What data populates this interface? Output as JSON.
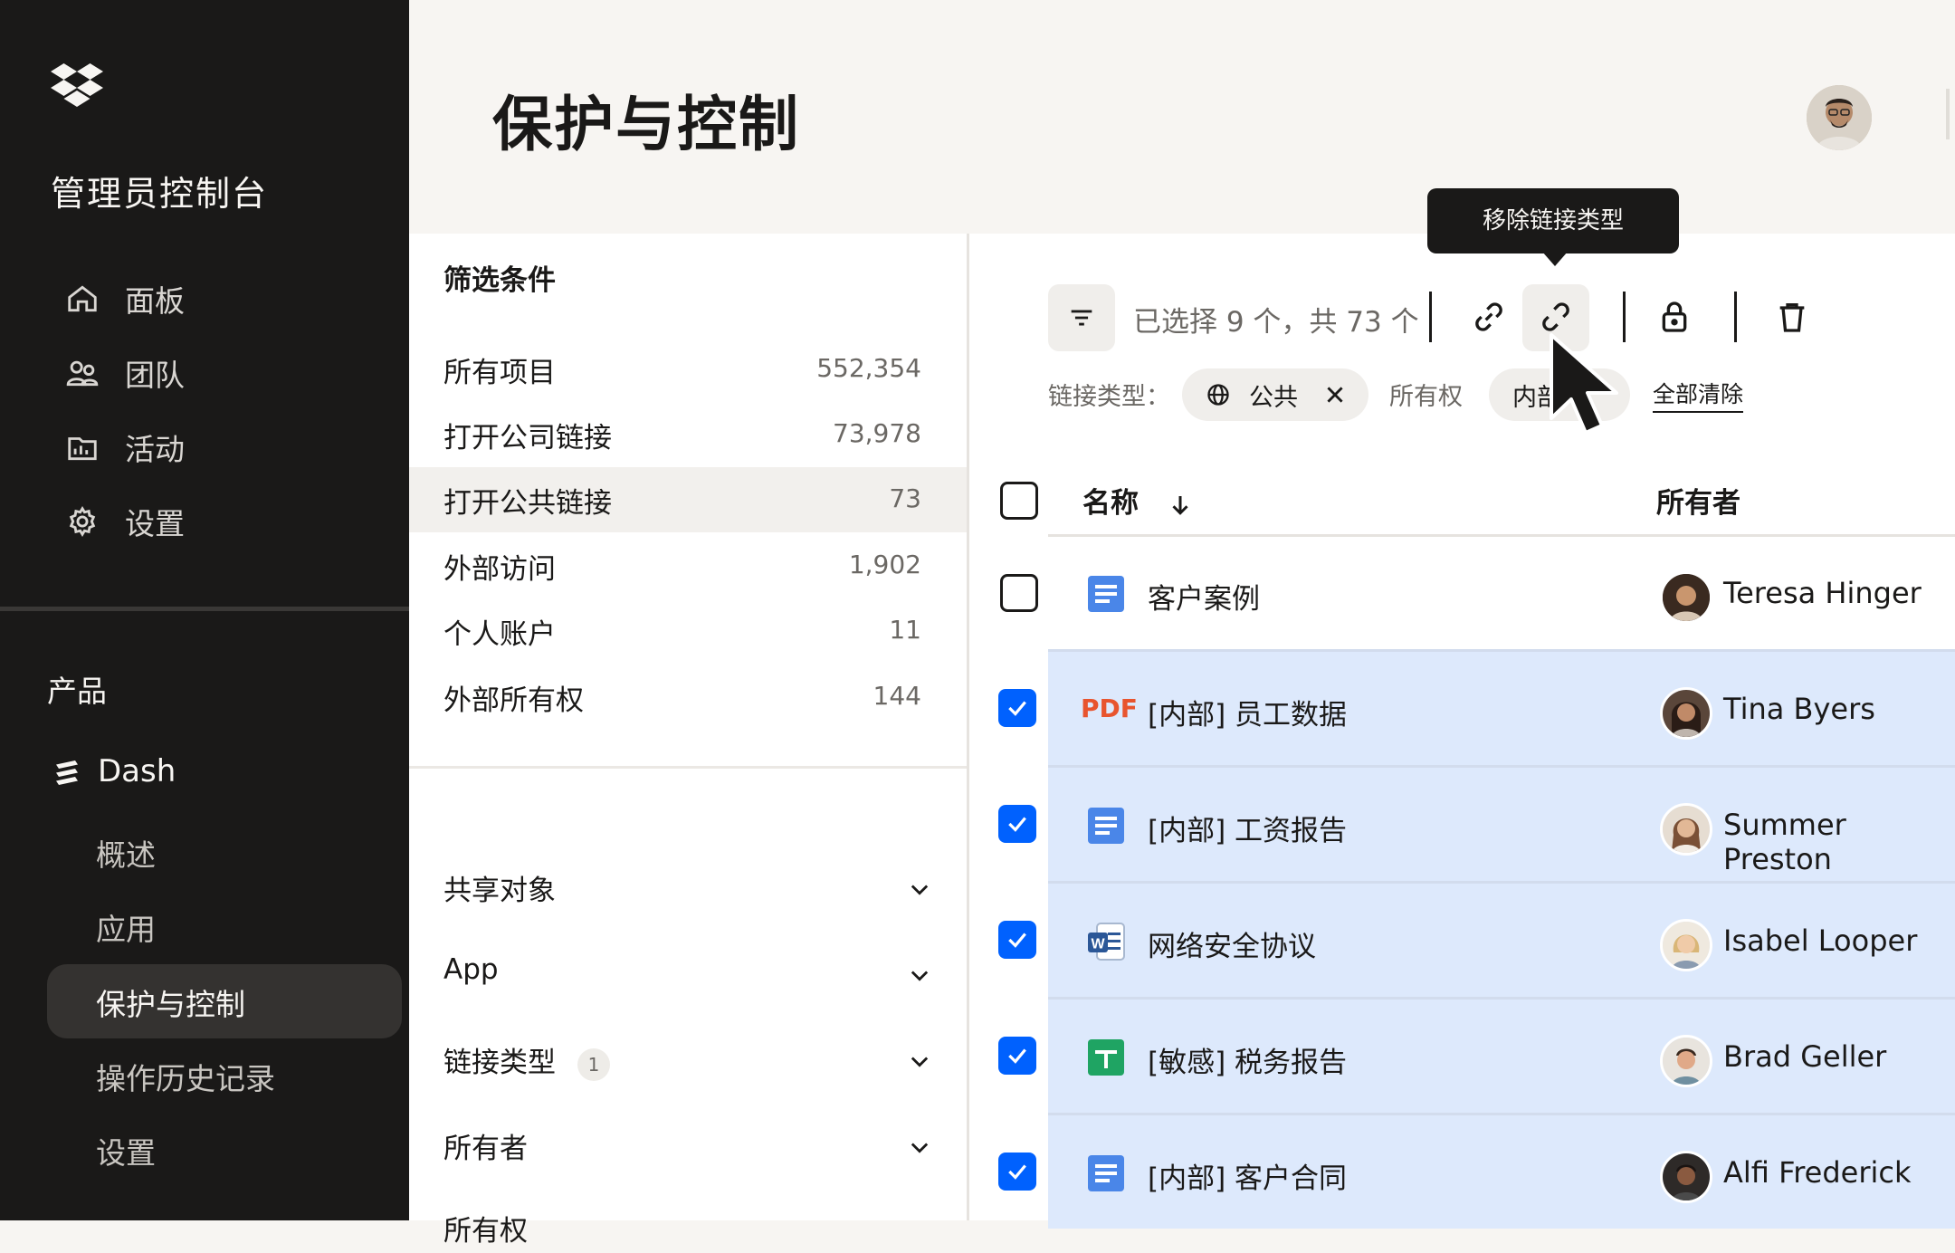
{
  "sidebar": {
    "app_title": "管理员控制台",
    "nav": [
      {
        "label": "面板",
        "icon": "home-icon"
      },
      {
        "label": "团队",
        "icon": "people-icon"
      },
      {
        "label": "活动",
        "icon": "activity-icon"
      },
      {
        "label": "设置",
        "icon": "gear-icon"
      }
    ],
    "section_label": "产品",
    "dash_label": "Dash",
    "sub_items": [
      "概述",
      "应用",
      "保护与控制",
      "操作历史记录",
      "设置"
    ],
    "active_sub_item": "保护与控制"
  },
  "header": {
    "title": "保护与控制"
  },
  "filters": {
    "title": "筛选条件",
    "rows": [
      {
        "label": "所有项目",
        "count": "552,354"
      },
      {
        "label": "打开公司链接",
        "count": "73,978"
      },
      {
        "label": "打开公共链接",
        "count": "73"
      },
      {
        "label": "外部访问",
        "count": "1,902"
      },
      {
        "label": "个人账户",
        "count": "11"
      },
      {
        "label": "外部所有权",
        "count": "144"
      }
    ],
    "selected_row": "打开公共链接",
    "accordions": [
      {
        "label": "共享对象"
      },
      {
        "label": "App"
      },
      {
        "label": "链接类型",
        "badge": "1"
      },
      {
        "label": "所有者"
      },
      {
        "label": "所有权"
      }
    ]
  },
  "toolbar": {
    "selection_text": "已选择 9 个，共 73 个",
    "tooltip": "移除链接类型",
    "link_type_label": "链接类型：",
    "chip_public": "公共",
    "ownership_label": "所有权",
    "chip_internal": "内部",
    "clear_all": "全部清除"
  },
  "table": {
    "col_name": "名称",
    "col_owner": "所有者",
    "rows": [
      {
        "name": "客户案例",
        "type": "doc",
        "owner": "Teresa Hinger",
        "checked": false
      },
      {
        "name": "[内部] 员工数据",
        "type": "pdf",
        "type_label": "PDF",
        "owner": "Tina Byers",
        "checked": true
      },
      {
        "name": "[内部] 工资报告",
        "type": "doc",
        "owner": "Summer Preston",
        "checked": true
      },
      {
        "name": "网络安全协议",
        "type": "word",
        "owner": "Isabel Looper",
        "checked": true
      },
      {
        "name": "[敏感] 税务报告",
        "type": "sheet",
        "owner": "Brad Geller",
        "checked": true
      },
      {
        "name": "[内部] 客户合同",
        "type": "doc",
        "owner": "Alfi Frederick",
        "checked": true
      }
    ]
  },
  "colors": {
    "accent": "#0061fe",
    "row_highlight": "#dde9fc",
    "sidebar_bg": "#1a1918",
    "pdf_red": "#e8542e"
  }
}
